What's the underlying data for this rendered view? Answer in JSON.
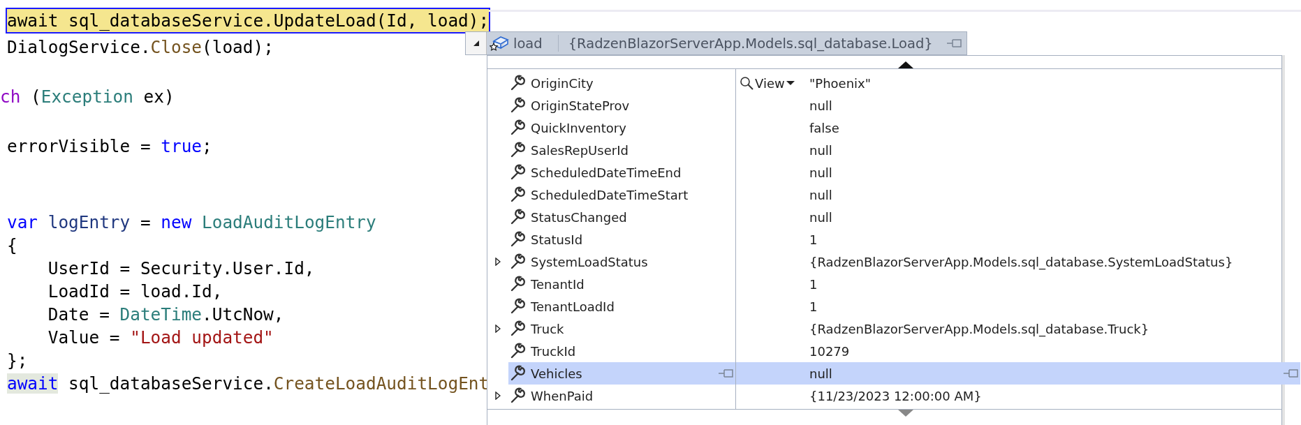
{
  "editor": {
    "lines": [
      {
        "kind": "code",
        "current": true,
        "tokens": [
          {
            "kind": "plain",
            "text": "await sql_databaseService.UpdateLoad(Id, load);"
          }
        ]
      },
      {
        "kind": "code",
        "tokens": [
          {
            "kind": "plain",
            "text": "DialogService."
          },
          {
            "kind": "method",
            "text": "Close"
          },
          {
            "kind": "plain",
            "text": "(load);"
          }
        ]
      },
      {
        "kind": "blank"
      },
      {
        "kind": "code",
        "clipped": true,
        "tokens": [
          {
            "kind": "control",
            "text": "ch"
          },
          {
            "kind": "plain",
            "text": " ("
          },
          {
            "kind": "type",
            "text": "Exception"
          },
          {
            "kind": "plain",
            "text": " ex)"
          }
        ]
      },
      {
        "kind": "blank"
      },
      {
        "kind": "code",
        "tokens": [
          {
            "kind": "plain",
            "text": "errorVisible = "
          },
          {
            "kind": "keyword",
            "text": "true"
          },
          {
            "kind": "plain",
            "text": ";"
          }
        ]
      },
      {
        "kind": "blank"
      },
      {
        "kind": "blank"
      },
      {
        "kind": "code",
        "tokens": [
          {
            "kind": "keyword",
            "text": "var"
          },
          {
            "kind": "local",
            "text": " logEntry"
          },
          {
            "kind": "plain",
            "text": " = "
          },
          {
            "kind": "keyword",
            "text": "new"
          },
          {
            "kind": "type",
            "text": " LoadAuditLogEntry"
          }
        ]
      },
      {
        "kind": "code",
        "tokens": [
          {
            "kind": "plain",
            "text": "{"
          }
        ]
      },
      {
        "kind": "code",
        "tokens": [
          {
            "kind": "plain",
            "text": "    UserId = Security.User.Id,"
          }
        ]
      },
      {
        "kind": "code",
        "tokens": [
          {
            "kind": "plain",
            "text": "    LoadId = load.Id,"
          }
        ]
      },
      {
        "kind": "code",
        "tokens": [
          {
            "kind": "plain",
            "text": "    Date = "
          },
          {
            "kind": "type",
            "text": "DateTime"
          },
          {
            "kind": "plain",
            "text": ".UtcNow,"
          }
        ]
      },
      {
        "kind": "code",
        "tokens": [
          {
            "kind": "plain",
            "text": "    Value = "
          },
          {
            "kind": "string",
            "text": "\"Load updated\""
          }
        ]
      },
      {
        "kind": "code",
        "tokens": [
          {
            "kind": "plain",
            "text": "};"
          }
        ]
      },
      {
        "kind": "code",
        "tokens": [
          {
            "kind": "reference",
            "text": "await"
          },
          {
            "kind": "plain",
            "text": " sql_databaseService."
          },
          {
            "kind": "method",
            "text": "CreateLoadAuditLogEnt"
          }
        ]
      }
    ]
  },
  "datatip": {
    "name": "load",
    "value": "{RadzenBlazorServerApp.Models.sql_database.Load}",
    "rows": [
      {
        "name": "OriginCity",
        "value": "\"Phoenix\"",
        "viewer": "View",
        "expandable": false,
        "selected": false
      },
      {
        "name": "OriginStateProv",
        "value": "null",
        "expandable": false,
        "selected": false
      },
      {
        "name": "QuickInventory",
        "value": "false",
        "expandable": false,
        "selected": false
      },
      {
        "name": "SalesRepUserId",
        "value": "null",
        "expandable": false,
        "selected": false
      },
      {
        "name": "ScheduledDateTimeEnd",
        "value": "null",
        "expandable": false,
        "selected": false
      },
      {
        "name": "ScheduledDateTimeStart",
        "value": "null",
        "expandable": false,
        "selected": false
      },
      {
        "name": "StatusChanged",
        "value": "null",
        "expandable": false,
        "selected": false
      },
      {
        "name": "StatusId",
        "value": "1",
        "expandable": false,
        "selected": false
      },
      {
        "name": "SystemLoadStatus",
        "value": "{RadzenBlazorServerApp.Models.sql_database.SystemLoadStatus}",
        "expandable": true,
        "selected": false
      },
      {
        "name": "TenantId",
        "value": "1",
        "expandable": false,
        "selected": false
      },
      {
        "name": "TenantLoadId",
        "value": "1",
        "expandable": false,
        "selected": false
      },
      {
        "name": "Truck",
        "value": "{RadzenBlazorServerApp.Models.sql_database.Truck}",
        "expandable": true,
        "selected": false
      },
      {
        "name": "TruckId",
        "value": "10279",
        "expandable": false,
        "selected": false
      },
      {
        "name": "Vehicles",
        "value": "null",
        "expandable": false,
        "selected": true
      },
      {
        "name": "WhenPaid",
        "value": "{11/23/2023 12:00:00 AM}",
        "expandable": true,
        "selected": false
      }
    ]
  }
}
